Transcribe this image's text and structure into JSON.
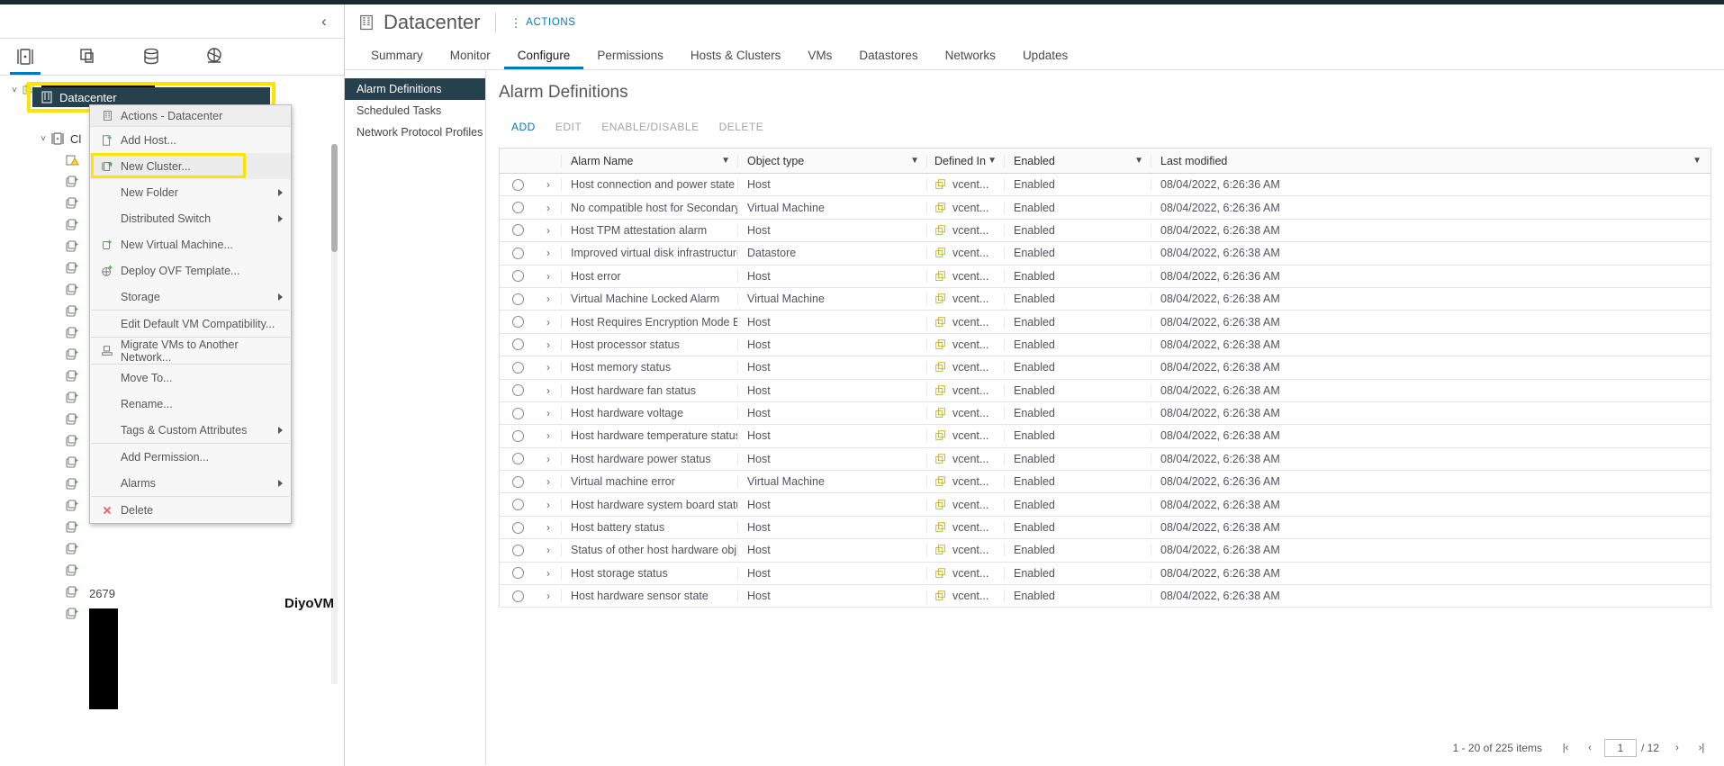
{
  "left_panel": {
    "collapse_icon": "chevron-left-icon",
    "icon_tabs": [
      {
        "name": "hosts-and-clusters-icon",
        "active": true
      },
      {
        "name": "vms-and-templates-icon",
        "active": false
      },
      {
        "name": "storage-icon",
        "active": false
      },
      {
        "name": "networking-icon",
        "active": false
      }
    ],
    "tree": {
      "root_label": "",
      "selected_label": "Datacenter",
      "cluster_label": "Cl",
      "count_label": "2679",
      "watermark": "DiyoVM"
    }
  },
  "context_menu": {
    "header": "Actions - Datacenter",
    "items": [
      {
        "label": "Add Host...",
        "icon": "add-host-icon",
        "submenu": false,
        "separator_after": false,
        "highlight": false
      },
      {
        "label": "New Cluster...",
        "icon": "new-cluster-icon",
        "submenu": false,
        "separator_after": false,
        "highlight": true
      },
      {
        "label": "New Folder",
        "icon": "",
        "submenu": true,
        "separator_after": false,
        "highlight": false
      },
      {
        "label": "Distributed Switch",
        "icon": "",
        "submenu": true,
        "separator_after": false,
        "highlight": false
      },
      {
        "label": "New Virtual Machine...",
        "icon": "new-vm-icon",
        "submenu": false,
        "separator_after": false,
        "highlight": false
      },
      {
        "label": "Deploy OVF Template...",
        "icon": "deploy-ovf-icon",
        "submenu": false,
        "separator_after": false,
        "highlight": false
      },
      {
        "label": "Storage",
        "icon": "",
        "submenu": true,
        "separator_after": true,
        "highlight": false
      },
      {
        "label": "Edit Default VM Compatibility...",
        "icon": "",
        "submenu": false,
        "separator_after": true,
        "highlight": false
      },
      {
        "label": "Migrate VMs to Another Network...",
        "icon": "migrate-network-icon",
        "submenu": false,
        "separator_after": true,
        "highlight": false
      },
      {
        "label": "Move To...",
        "icon": "",
        "submenu": false,
        "separator_after": false,
        "highlight": false
      },
      {
        "label": "Rename...",
        "icon": "",
        "submenu": false,
        "separator_after": false,
        "highlight": false
      },
      {
        "label": "Tags & Custom Attributes",
        "icon": "",
        "submenu": true,
        "separator_after": true,
        "highlight": false
      },
      {
        "label": "Add Permission...",
        "icon": "",
        "submenu": false,
        "separator_after": false,
        "highlight": false
      },
      {
        "label": "Alarms",
        "icon": "",
        "submenu": true,
        "separator_after": true,
        "highlight": false
      },
      {
        "label": "Delete",
        "icon": "delete-icon",
        "submenu": false,
        "separator_after": false,
        "highlight": false
      }
    ]
  },
  "header": {
    "object_icon": "datacenter-icon",
    "title": "Datacenter",
    "actions_label": "ACTIONS"
  },
  "tabs": [
    {
      "label": "Summary",
      "active": false
    },
    {
      "label": "Monitor",
      "active": false
    },
    {
      "label": "Configure",
      "active": true
    },
    {
      "label": "Permissions",
      "active": false
    },
    {
      "label": "Hosts & Clusters",
      "active": false
    },
    {
      "label": "VMs",
      "active": false
    },
    {
      "label": "Datastores",
      "active": false
    },
    {
      "label": "Networks",
      "active": false
    },
    {
      "label": "Updates",
      "active": false
    }
  ],
  "sub_nav": [
    {
      "label": "Alarm Definitions",
      "active": true
    },
    {
      "label": "Scheduled Tasks",
      "active": false
    },
    {
      "label": "Network Protocol Profiles",
      "active": false
    }
  ],
  "content": {
    "title": "Alarm Definitions",
    "toolbar": [
      {
        "label": "ADD",
        "enabled": true
      },
      {
        "label": "EDIT",
        "enabled": false
      },
      {
        "label": "ENABLE/DISABLE",
        "enabled": false
      },
      {
        "label": "DELETE",
        "enabled": false
      }
    ],
    "table": {
      "columns": [
        {
          "label": "Alarm Name",
          "filter": true
        },
        {
          "label": "Object type",
          "filter": true
        },
        {
          "label": "Defined In",
          "filter": true
        },
        {
          "label": "Enabled",
          "filter": true
        },
        {
          "label": "Last modified",
          "filter": true
        }
      ],
      "rows": [
        {
          "name": "Host connection and power state",
          "type": "Host",
          "defined_in": "vcent...",
          "enabled": "Enabled",
          "modified": "08/04/2022, 6:26:36 AM"
        },
        {
          "name": "No compatible host for Secondary...",
          "type": "Virtual Machine",
          "defined_in": "vcent...",
          "enabled": "Enabled",
          "modified": "08/04/2022, 6:26:36 AM"
        },
        {
          "name": "Host TPM attestation alarm",
          "type": "Host",
          "defined_in": "vcent...",
          "enabled": "Enabled",
          "modified": "08/04/2022, 6:26:38 AM"
        },
        {
          "name": "Improved virtual disk infrastructure...",
          "type": "Datastore",
          "defined_in": "vcent...",
          "enabled": "Enabled",
          "modified": "08/04/2022, 6:26:38 AM"
        },
        {
          "name": "Host error",
          "type": "Host",
          "defined_in": "vcent...",
          "enabled": "Enabled",
          "modified": "08/04/2022, 6:26:36 AM"
        },
        {
          "name": "Virtual Machine Locked Alarm",
          "type": "Virtual Machine",
          "defined_in": "vcent...",
          "enabled": "Enabled",
          "modified": "08/04/2022, 6:26:38 AM"
        },
        {
          "name": "Host Requires Encryption Mode En...",
          "type": "Host",
          "defined_in": "vcent...",
          "enabled": "Enabled",
          "modified": "08/04/2022, 6:26:38 AM"
        },
        {
          "name": "Host processor status",
          "type": "Host",
          "defined_in": "vcent...",
          "enabled": "Enabled",
          "modified": "08/04/2022, 6:26:38 AM"
        },
        {
          "name": "Host memory status",
          "type": "Host",
          "defined_in": "vcent...",
          "enabled": "Enabled",
          "modified": "08/04/2022, 6:26:38 AM"
        },
        {
          "name": "Host hardware fan status",
          "type": "Host",
          "defined_in": "vcent...",
          "enabled": "Enabled",
          "modified": "08/04/2022, 6:26:38 AM"
        },
        {
          "name": "Host hardware voltage",
          "type": "Host",
          "defined_in": "vcent...",
          "enabled": "Enabled",
          "modified": "08/04/2022, 6:26:38 AM"
        },
        {
          "name": "Host hardware temperature status",
          "type": "Host",
          "defined_in": "vcent...",
          "enabled": "Enabled",
          "modified": "08/04/2022, 6:26:38 AM"
        },
        {
          "name": "Host hardware power status",
          "type": "Host",
          "defined_in": "vcent...",
          "enabled": "Enabled",
          "modified": "08/04/2022, 6:26:38 AM"
        },
        {
          "name": "Virtual machine error",
          "type": "Virtual Machine",
          "defined_in": "vcent...",
          "enabled": "Enabled",
          "modified": "08/04/2022, 6:26:36 AM"
        },
        {
          "name": "Host hardware system board status",
          "type": "Host",
          "defined_in": "vcent...",
          "enabled": "Enabled",
          "modified": "08/04/2022, 6:26:38 AM"
        },
        {
          "name": "Host battery status",
          "type": "Host",
          "defined_in": "vcent...",
          "enabled": "Enabled",
          "modified": "08/04/2022, 6:26:38 AM"
        },
        {
          "name": "Status of other host hardware obj...",
          "type": "Host",
          "defined_in": "vcent...",
          "enabled": "Enabled",
          "modified": "08/04/2022, 6:26:38 AM"
        },
        {
          "name": "Host storage status",
          "type": "Host",
          "defined_in": "vcent...",
          "enabled": "Enabled",
          "modified": "08/04/2022, 6:26:38 AM"
        },
        {
          "name": "Host hardware sensor state",
          "type": "Host",
          "defined_in": "vcent...",
          "enabled": "Enabled",
          "modified": "08/04/2022, 6:26:38 AM"
        }
      ]
    },
    "pager": {
      "summary": "1 - 20 of 225 items",
      "page_value": "1",
      "page_total": "/ 12",
      "first_icon": "first-page-icon",
      "prev_icon": "previous-page-icon",
      "next_icon": "next-page-icon",
      "last_icon": "last-page-icon"
    }
  },
  "colors": {
    "accent": "#0079b8",
    "selected_bg": "#27404e",
    "highlight": "#ffe400"
  }
}
